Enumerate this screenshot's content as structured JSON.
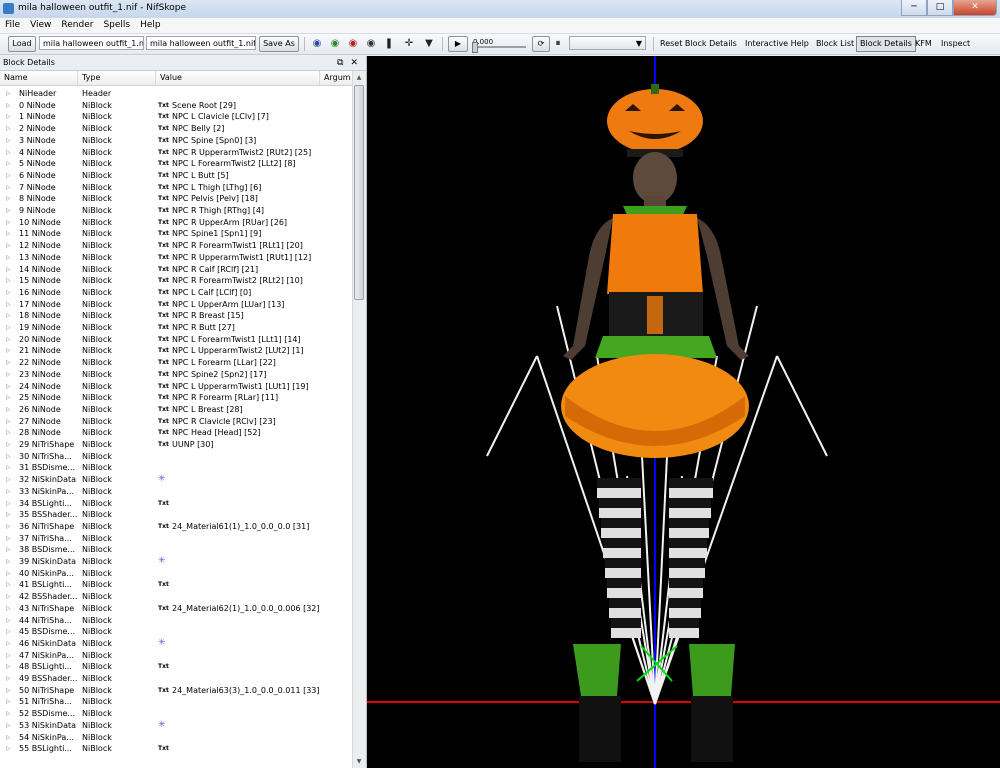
{
  "window": {
    "title": "mila halloween outfit_1.nif - NifSkope",
    "min": "─",
    "max": "□",
    "close": "✕"
  },
  "menu": [
    "File",
    "View",
    "Render",
    "Spells",
    "Help"
  ],
  "toolbar": {
    "load": "Load",
    "file_in": "mila halloween outfit_1.nif",
    "file_out": "mila halloween outfit_1.nif",
    "save_as": "Save As",
    "time_value": "0.000",
    "links": [
      "Reset Block Details",
      "Interactive Help",
      "Block List",
      "Block Details",
      "KFM",
      "Inspect"
    ]
  },
  "panel": {
    "title": "Block Details",
    "float_btn": "⧉",
    "close_btn": "✕",
    "columns": [
      "Name",
      "Type",
      "Value",
      "Argum"
    ]
  },
  "rows": [
    {
      "name": "NiHeader",
      "type": "Header",
      "value": "",
      "icon": ""
    },
    {
      "name": "0 NiNode",
      "type": "NiBlock",
      "value": "Scene Root [29]",
      "icon": "txt"
    },
    {
      "name": "1 NiNode",
      "type": "NiBlock",
      "value": "NPC L Clavicle [LClv] [7]",
      "icon": "txt"
    },
    {
      "name": "2 NiNode",
      "type": "NiBlock",
      "value": "NPC Belly [2]",
      "icon": "txt"
    },
    {
      "name": "3 NiNode",
      "type": "NiBlock",
      "value": "NPC Spine [Spn0] [3]",
      "icon": "txt"
    },
    {
      "name": "4 NiNode",
      "type": "NiBlock",
      "value": "NPC R UpperarmTwist2 [RUt2] [25]",
      "icon": "txt"
    },
    {
      "name": "5 NiNode",
      "type": "NiBlock",
      "value": "NPC L ForearmTwist2 [LLt2] [8]",
      "icon": "txt"
    },
    {
      "name": "6 NiNode",
      "type": "NiBlock",
      "value": "NPC L Butt [5]",
      "icon": "txt"
    },
    {
      "name": "7 NiNode",
      "type": "NiBlock",
      "value": "NPC L Thigh [LThg] [6]",
      "icon": "txt"
    },
    {
      "name": "8 NiNode",
      "type": "NiBlock",
      "value": "NPC Pelvis [Pelv] [18]",
      "icon": "txt"
    },
    {
      "name": "9 NiNode",
      "type": "NiBlock",
      "value": "NPC R Thigh [RThg] [4]",
      "icon": "txt"
    },
    {
      "name": "10 NiNode",
      "type": "NiBlock",
      "value": "NPC R UpperArm [RUar] [26]",
      "icon": "txt"
    },
    {
      "name": "11 NiNode",
      "type": "NiBlock",
      "value": "NPC Spine1 [Spn1] [9]",
      "icon": "txt"
    },
    {
      "name": "12 NiNode",
      "type": "NiBlock",
      "value": "NPC R ForearmTwist1 [RLt1] [20]",
      "icon": "txt"
    },
    {
      "name": "13 NiNode",
      "type": "NiBlock",
      "value": "NPC R UpperarmTwist1 [RUt1] [12]",
      "icon": "txt"
    },
    {
      "name": "14 NiNode",
      "type": "NiBlock",
      "value": "NPC R Calf [RClf] [21]",
      "icon": "txt"
    },
    {
      "name": "15 NiNode",
      "type": "NiBlock",
      "value": "NPC R ForearmTwist2 [RLt2] [10]",
      "icon": "txt"
    },
    {
      "name": "16 NiNode",
      "type": "NiBlock",
      "value": "NPC L Calf [LClf] [0]",
      "icon": "txt"
    },
    {
      "name": "17 NiNode",
      "type": "NiBlock",
      "value": "NPC L UpperArm [LUar] [13]",
      "icon": "txt"
    },
    {
      "name": "18 NiNode",
      "type": "NiBlock",
      "value": "NPC R Breast [15]",
      "icon": "txt"
    },
    {
      "name": "19 NiNode",
      "type": "NiBlock",
      "value": "NPC R Butt [27]",
      "icon": "txt"
    },
    {
      "name": "20 NiNode",
      "type": "NiBlock",
      "value": "NPC L ForearmTwist1 [LLt1] [14]",
      "icon": "txt"
    },
    {
      "name": "21 NiNode",
      "type": "NiBlock",
      "value": "NPC L UpperarmTwist2 [LUt2] [1]",
      "icon": "txt"
    },
    {
      "name": "22 NiNode",
      "type": "NiBlock",
      "value": "NPC L Forearm [LLar] [22]",
      "icon": "txt"
    },
    {
      "name": "23 NiNode",
      "type": "NiBlock",
      "value": "NPC Spine2 [Spn2] [17]",
      "icon": "txt"
    },
    {
      "name": "24 NiNode",
      "type": "NiBlock",
      "value": "NPC L UpperarmTwist1 [LUt1] [19]",
      "icon": "txt"
    },
    {
      "name": "25 NiNode",
      "type": "NiBlock",
      "value": "NPC R Forearm [RLar] [11]",
      "icon": "txt"
    },
    {
      "name": "26 NiNode",
      "type": "NiBlock",
      "value": "NPC L Breast [28]",
      "icon": "txt"
    },
    {
      "name": "27 NiNode",
      "type": "NiBlock",
      "value": "NPC R Clavicle [RClv] [23]",
      "icon": "txt"
    },
    {
      "name": "28 NiNode",
      "type": "NiBlock",
      "value": "NPC Head [Head] [52]",
      "icon": "txt"
    },
    {
      "name": "29 NiTriShape",
      "type": "NiBlock",
      "value": "UUNP [30]",
      "icon": "txt"
    },
    {
      "name": "30 NiTriSha...",
      "type": "NiBlock",
      "value": "",
      "icon": ""
    },
    {
      "name": "31 BSDisme...",
      "type": "NiBlock",
      "value": "",
      "icon": ""
    },
    {
      "name": "32 NiSkinData",
      "type": "NiBlock",
      "value": "",
      "icon": "x"
    },
    {
      "name": "33 NiSkinPa...",
      "type": "NiBlock",
      "value": "",
      "icon": ""
    },
    {
      "name": "34 BSLighti...",
      "type": "NiBlock",
      "value": "",
      "icon": "txt"
    },
    {
      "name": "35 BSShader...",
      "type": "NiBlock",
      "value": "",
      "icon": ""
    },
    {
      "name": "36 NiTriShape",
      "type": "NiBlock",
      "value": "24_Material61(1)_1.0_0.0_0.0 [31]",
      "icon": "txt"
    },
    {
      "name": "37 NiTriSha...",
      "type": "NiBlock",
      "value": "",
      "icon": ""
    },
    {
      "name": "38 BSDisme...",
      "type": "NiBlock",
      "value": "",
      "icon": ""
    },
    {
      "name": "39 NiSkinData",
      "type": "NiBlock",
      "value": "",
      "icon": "x"
    },
    {
      "name": "40 NiSkinPa...",
      "type": "NiBlock",
      "value": "",
      "icon": ""
    },
    {
      "name": "41 BSLighti...",
      "type": "NiBlock",
      "value": "",
      "icon": "txt"
    },
    {
      "name": "42 BSShader...",
      "type": "NiBlock",
      "value": "",
      "icon": ""
    },
    {
      "name": "43 NiTriShape",
      "type": "NiBlock",
      "value": "24_Material62(1)_1.0_0.0_0.006 [32]",
      "icon": "txt"
    },
    {
      "name": "44 NiTriSha...",
      "type": "NiBlock",
      "value": "",
      "icon": ""
    },
    {
      "name": "45 BSDisme...",
      "type": "NiBlock",
      "value": "",
      "icon": ""
    },
    {
      "name": "46 NiSkinData",
      "type": "NiBlock",
      "value": "",
      "icon": "x"
    },
    {
      "name": "47 NiSkinPa...",
      "type": "NiBlock",
      "value": "",
      "icon": ""
    },
    {
      "name": "48 BSLighti...",
      "type": "NiBlock",
      "value": "",
      "icon": "txt"
    },
    {
      "name": "49 BSShader...",
      "type": "NiBlock",
      "value": "",
      "icon": ""
    },
    {
      "name": "50 NiTriShape",
      "type": "NiBlock",
      "value": "24_Material63(3)_1.0_0.0_0.011 [33]",
      "icon": "txt"
    },
    {
      "name": "51 NiTriSha...",
      "type": "NiBlock",
      "value": "",
      "icon": ""
    },
    {
      "name": "52 BSDisme...",
      "type": "NiBlock",
      "value": "",
      "icon": ""
    },
    {
      "name": "53 NiSkinData",
      "type": "NiBlock",
      "value": "",
      "icon": "x"
    },
    {
      "name": "54 NiSkinPa...",
      "type": "NiBlock",
      "value": "",
      "icon": ""
    },
    {
      "name": "55 BSLighti...",
      "type": "NiBlock",
      "value": "",
      "icon": "txt"
    }
  ],
  "txt_glyph": "Txt",
  "x_glyph": "✳",
  "arrow_glyph": "▷",
  "colors": {
    "x_axis": "#ff0000",
    "y_axis": "#0000ff",
    "z_axis": "#00ff00",
    "orange": "#f07a0c",
    "viewport_bg": "#000000"
  }
}
